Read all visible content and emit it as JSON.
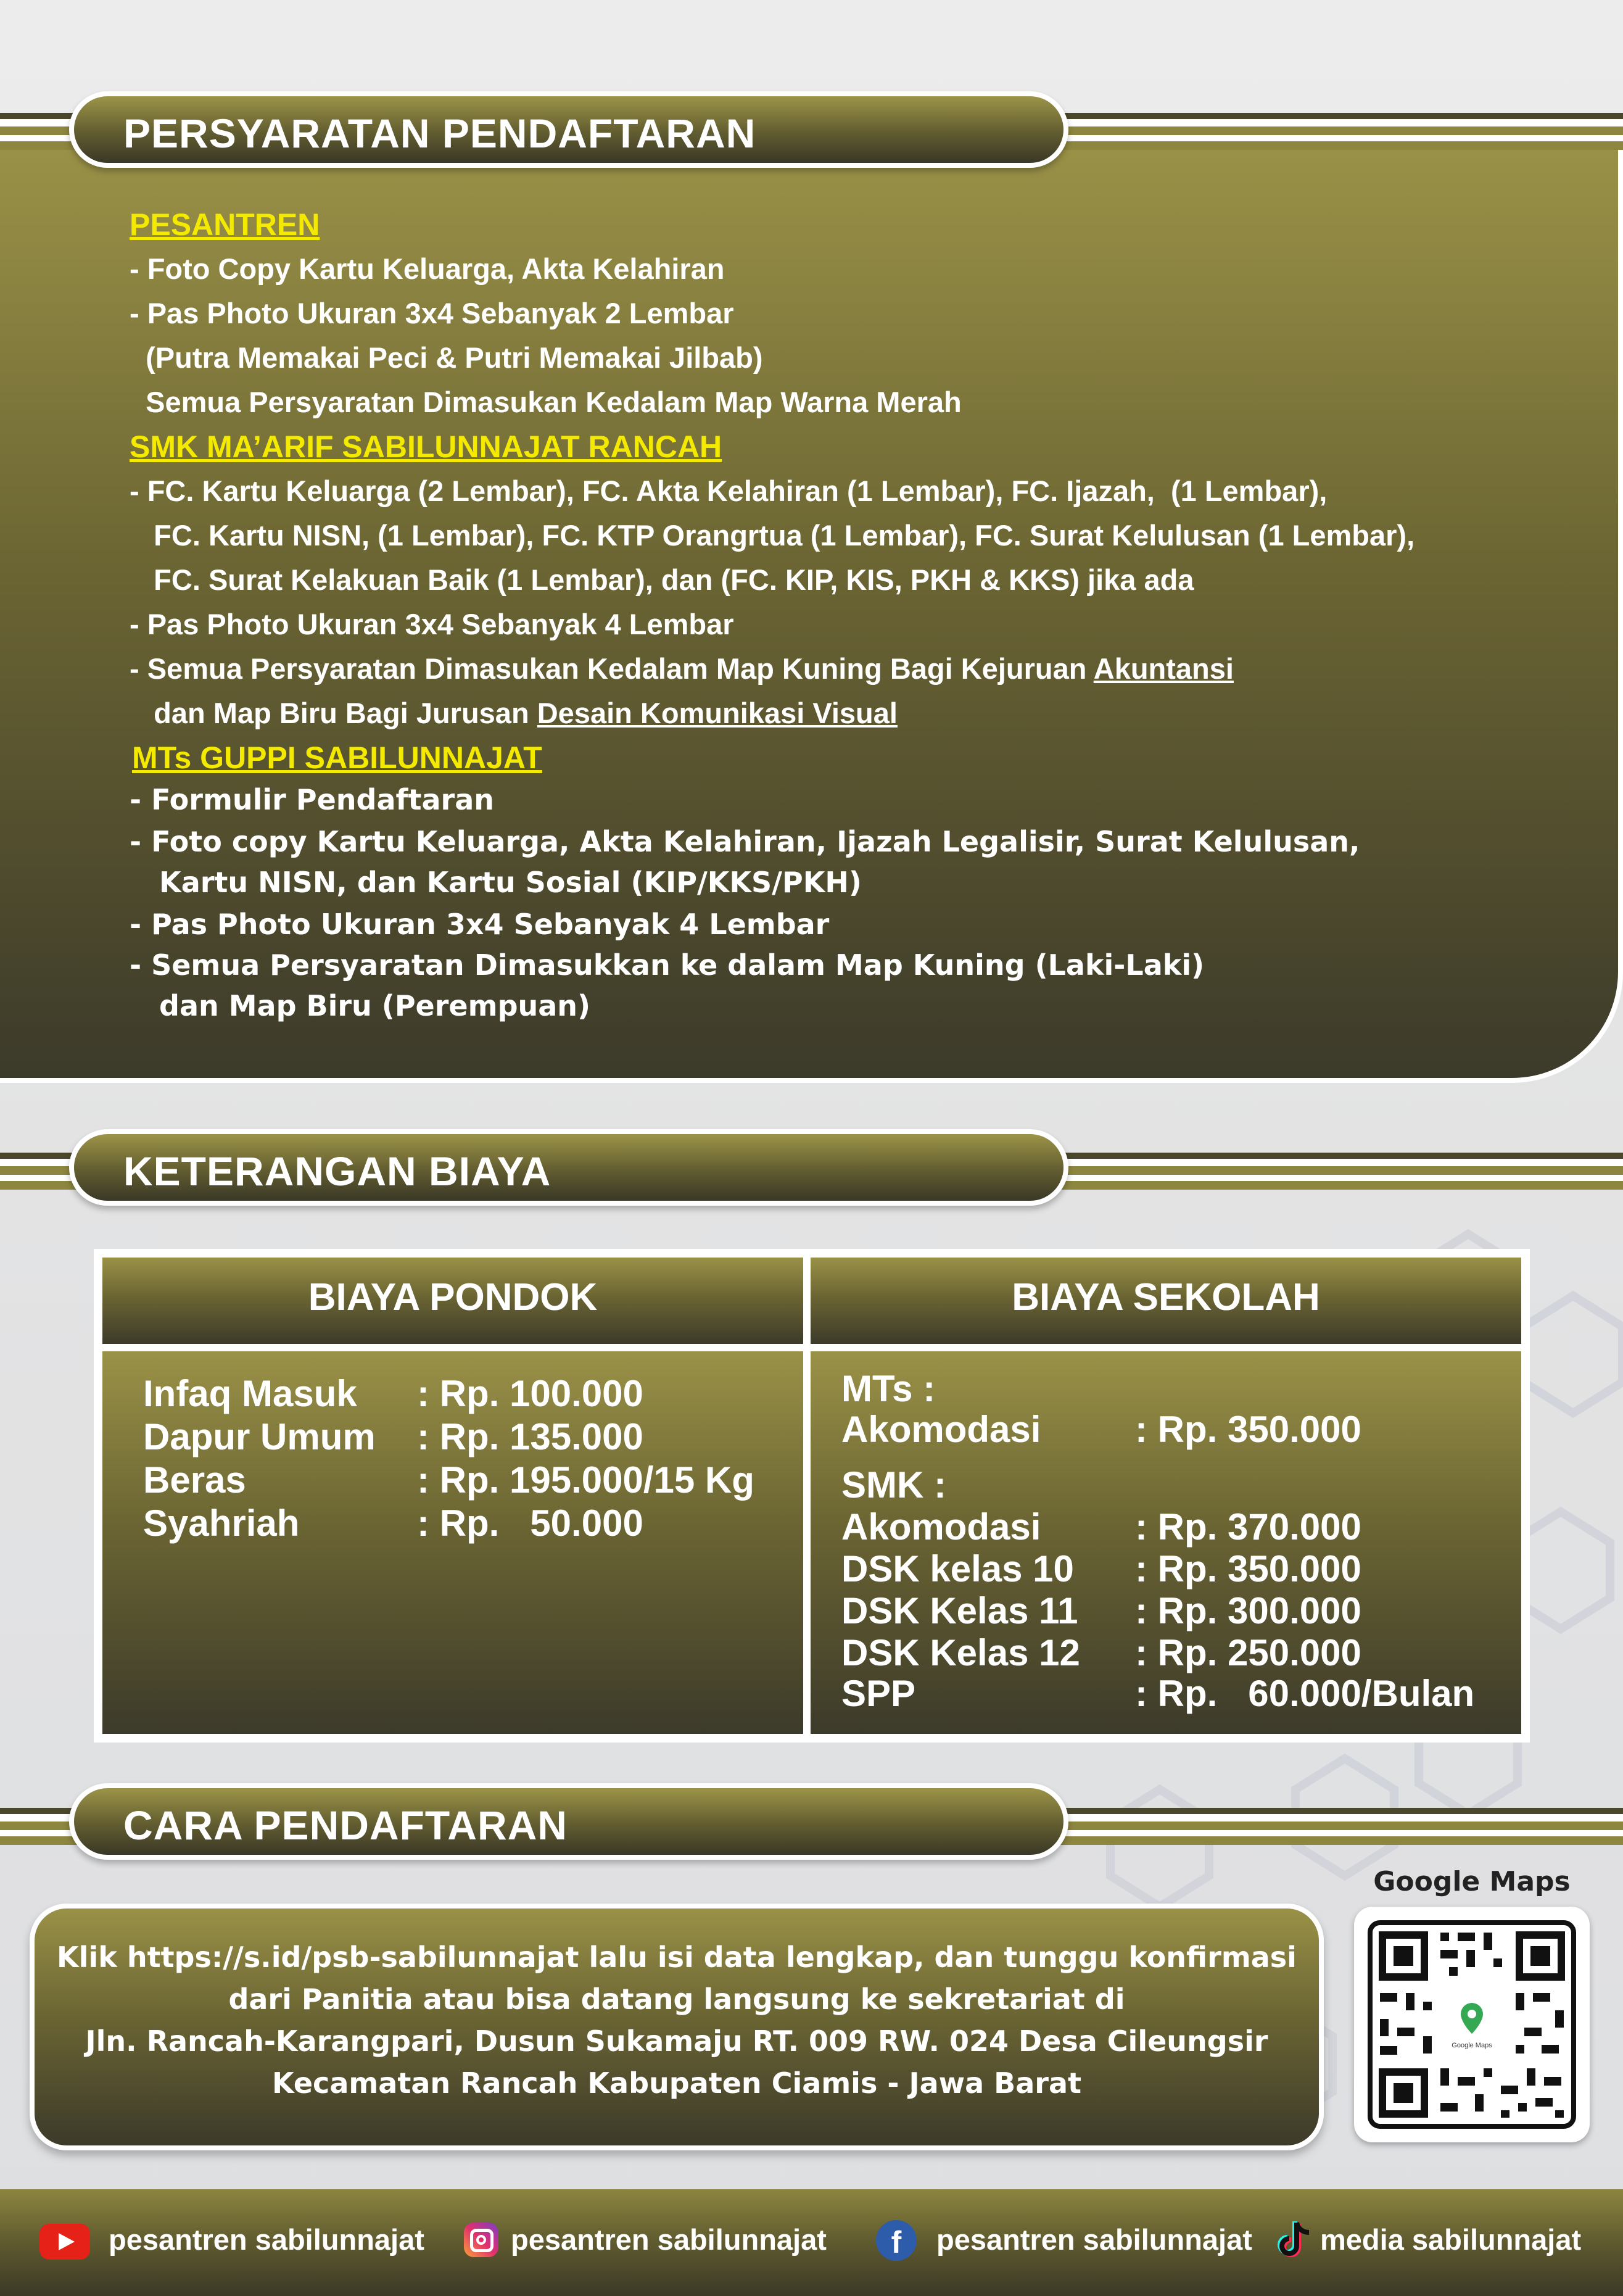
{
  "requirements": {
    "title": "PERSYARATAN PENDAFTARAN",
    "pesantren": {
      "heading": "PESANTREN",
      "lines": [
        "- Foto Copy Kartu Keluarga, Akta Kelahiran",
        "- Pas Photo Ukuran 3x4 Sebanyak 2 Lembar",
        "  (Putra Memakai Peci & Putri Memakai Jilbab)",
        "  Semua Persyaratan Dimasukan Kedalam Map Warna Merah"
      ]
    },
    "smk": {
      "heading": "SMK MA’ARIF SABILUNNAJAT RANCAH",
      "lines": [
        "- FC. Kartu Keluarga (2 Lembar), FC. Akta Kelahiran (1 Lembar), FC. Ijazah,  (1 Lembar),",
        "   FC. Kartu NISN, (1 Lembar), FC. KTP Orangrtua (1 Lembar), FC. Surat Kelulusan (1 Lembar),",
        "   FC. Surat Kelakuan Baik (1 Lembar), dan (FC. KIP, KIS, PKH & KKS) jika ada",
        "- Pas Photo Ukuran 3x4 Sebanyak 4 Lembar"
      ],
      "line5_prefix": "- Semua Persyaratan Dimasukan Kedalam Map Kuning Bagi Kejuruan ",
      "line5_link": "Akuntansi",
      "line6_prefix": "   dan Map Biru Bagi Jurusan ",
      "line6_link": "Desain Komunikasi Visual"
    },
    "mts": {
      "heading": "MTs GUPPI SABILUNNAJAT",
      "lines": [
        "- Formulir Pendaftaran",
        "- Foto copy Kartu Keluarga, Akta Kelahiran, Ijazah Legalisir, Surat Kelulusan,",
        "   Kartu NISN, dan Kartu Sosial (KIP/KKS/PKH)",
        "- Pas Photo Ukuran 3x4 Sebanyak 4 Lembar",
        "- Semua Persyaratan Dimasukkan ke dalam Map Kuning (Laki-Laki)",
        "   dan Map Biru (Perempuan)"
      ]
    }
  },
  "fees": {
    "title": "KETERANGAN BIAYA",
    "pondok_header": "BIAYA PONDOK",
    "sekolah_header": "BIAYA SEKOLAH",
    "pondok": [
      {
        "label": "Infaq Masuk",
        "value": ": Rp. 100.000"
      },
      {
        "label": "Dapur Umum",
        "value": ": Rp. 135.000"
      },
      {
        "label": "Beras",
        "value": ": Rp. 195.000/15 Kg"
      },
      {
        "label": "Syahriah",
        "value": ": Rp.   50.000"
      }
    ],
    "mts_label": "MTs :",
    "mts": [
      {
        "label": "Akomodasi",
        "value": ": Rp. 350.000"
      }
    ],
    "smk_label": "SMK :",
    "smk": [
      {
        "label": "Akomodasi",
        "value": ": Rp. 370.000"
      },
      {
        "label": "DSK kelas 10",
        "value": ": Rp. 350.000"
      },
      {
        "label": "DSK Kelas 11",
        "value": ": Rp. 300.000"
      },
      {
        "label": "DSK Kelas 12",
        "value": ": Rp. 250.000"
      },
      {
        "label": "SPP",
        "value": ": Rp.   60.000/Bulan"
      }
    ]
  },
  "registration": {
    "title": "CARA PENDAFTARAN",
    "line1_prefix": "Klik ",
    "line1_link": "https://s.id/psb-sabilunnajat",
    "line1_suffix": " lalu isi data lengkap, dan tunggu konfirmasi",
    "line2": "dari Panitia atau bisa datang langsung ke sekretariat di",
    "line3": "Jln. Rancah-Karangpari, Dusun Sukamaju RT. 009 RW. 024 Desa Cileungsir",
    "line4": "Kecamatan Rancah Kabupaten Ciamis - Jawa Barat",
    "maps_label": "Google Maps",
    "qr_center_text": "Google Maps"
  },
  "footer": {
    "youtube": "pesantren sabilunnajat",
    "instagram": "pesantren sabilunnajat",
    "facebook": "pesantren sabilunnajat",
    "tiktok": "media sabilunnajat"
  },
  "colors": {
    "olive": "#8d863f",
    "dark_olive": "#3c3a2a",
    "highlight_yellow": "#f4ea00"
  }
}
